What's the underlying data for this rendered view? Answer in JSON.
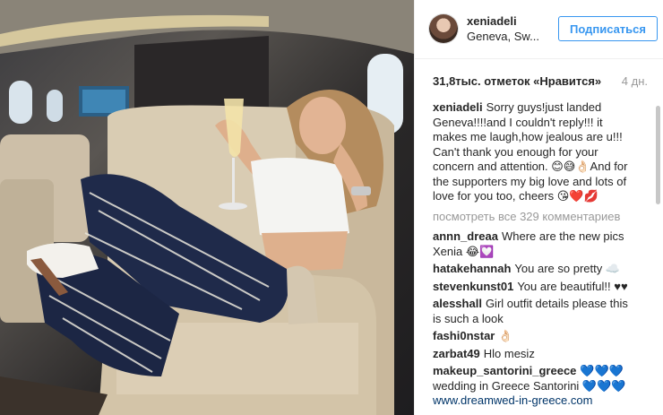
{
  "post": {
    "username": "xeniadeli",
    "location": "Geneva, Sw...",
    "follow_label": "Подписаться",
    "likes": "31,8тыс. отметок «Нравится»",
    "time_ago": "4 дн.",
    "caption_user": "xeniadeli",
    "caption_text": "Sorry guys!just landed Geneva!!!!and I couldn't reply!!! it makes me laugh,how jealous are u!!! Can't thank you enough for your concern and attention. 😊😅👌🏻And for the supporters my big love and lots of love for you too, cheers 😘❤️💋",
    "view_all": "посмотреть все 329 комментариев"
  },
  "comments": [
    {
      "user": "annn_dreaa",
      "text": "Where are the new pics Xenia 😂💟"
    },
    {
      "user": "hatakehannah",
      "text": "You are so pretty ☁️"
    },
    {
      "user": "stevenkunst01",
      "text": "You are beautiful!! ♥♥"
    },
    {
      "user": "alesshall",
      "text": "Girl outfit details please this is such a look"
    },
    {
      "user": "fashi0nstar",
      "text": "👌🏻"
    },
    {
      "user": "zarbat49",
      "text": "Hlo mesiz"
    },
    {
      "user": "makeup_santorini_greece",
      "text": "💙💙💙 wedding in Greece Santorini 💙💙💙",
      "link": "www.dreamwed-in-greece.com"
    }
  ]
}
